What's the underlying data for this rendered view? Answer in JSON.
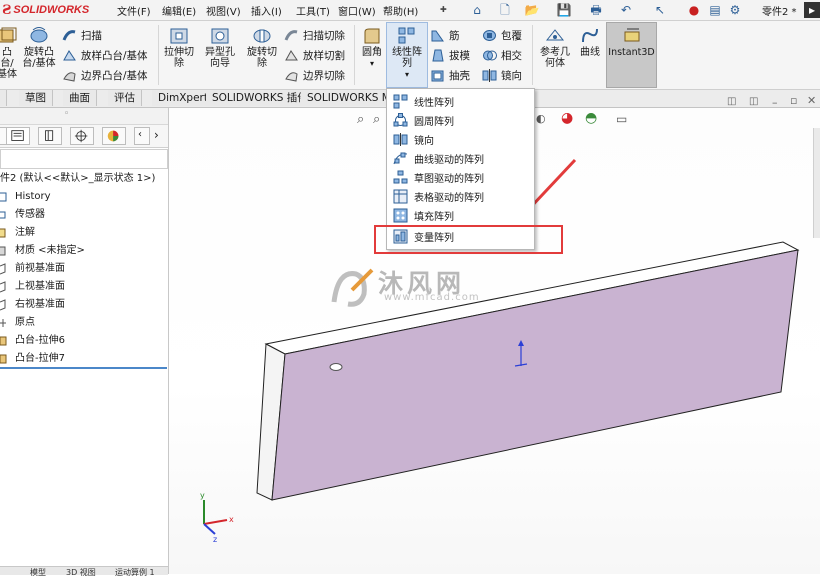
{
  "app": {
    "logo_ds": "Ƨ",
    "logo_text": "SOLIDWORKS"
  },
  "menu": {
    "items": [
      "文件(F)",
      "编辑(E)",
      "视图(V)",
      "插入(I)",
      "工具(T)",
      "窗口(W)",
      "帮助(H)"
    ],
    "document_title": "零件2 *"
  },
  "toolbar": {
    "boss_base_label": "凸台/基体",
    "revolve_boss_label": "旋转凸台/基体",
    "sweep_label": "扫描",
    "loft_boss_label": "放样凸台/基体",
    "boundary_boss_label": "边界凸台/基体",
    "extruded_cut_label": "拉伸切除",
    "hole_wizard_label": "异型孔向导",
    "revolve_cut_label": "旋转切除",
    "swept_cut_label": "扫描切除",
    "lofted_cut_label": "放样切割",
    "boundary_cut_label": "边界切除",
    "fillet_label": "圆角",
    "linear_pattern_label": "线性阵列",
    "rib_label": "筋",
    "draft_label": "拔模",
    "shell_label": "抽壳",
    "wrap_label": "包覆",
    "intersect_label": "相交",
    "mirror_label": "镜向",
    "ref_geometry_label": "参考几何体",
    "curves_label": "曲线",
    "instant3d_label": "Instant3D"
  },
  "tabs": [
    "草图",
    "曲面",
    "评估",
    "DimXpert",
    "SOLIDWORKS 插件",
    "SOLIDWORKS MBD"
  ],
  "tree": {
    "root": "件2 (默认<<默认>_显示状态 1>)",
    "items": [
      "History",
      "传感器",
      "注解",
      "材质 <未指定>",
      "前视基准面",
      "上视基准面",
      "右视基准面",
      "原点",
      "凸台-拉伸6",
      "凸台-拉伸7"
    ]
  },
  "pattern_menu": {
    "items": [
      "线性阵列",
      "圆周阵列",
      "镜向",
      "曲线驱动的阵列",
      "草图驱动的阵列",
      "表格驱动的阵列",
      "填充阵列",
      "变量阵列"
    ],
    "highlighted": "变量阵列"
  },
  "watermark": {
    "text": "沐风网",
    "url": "www.mfcad.com"
  },
  "bottom_tabs": [
    "模型",
    "3D 视图",
    "运动算例 1"
  ],
  "colors": {
    "accent": "#d4262c",
    "part_face": "#c9b3d1",
    "arrow": "#e23b3b"
  }
}
